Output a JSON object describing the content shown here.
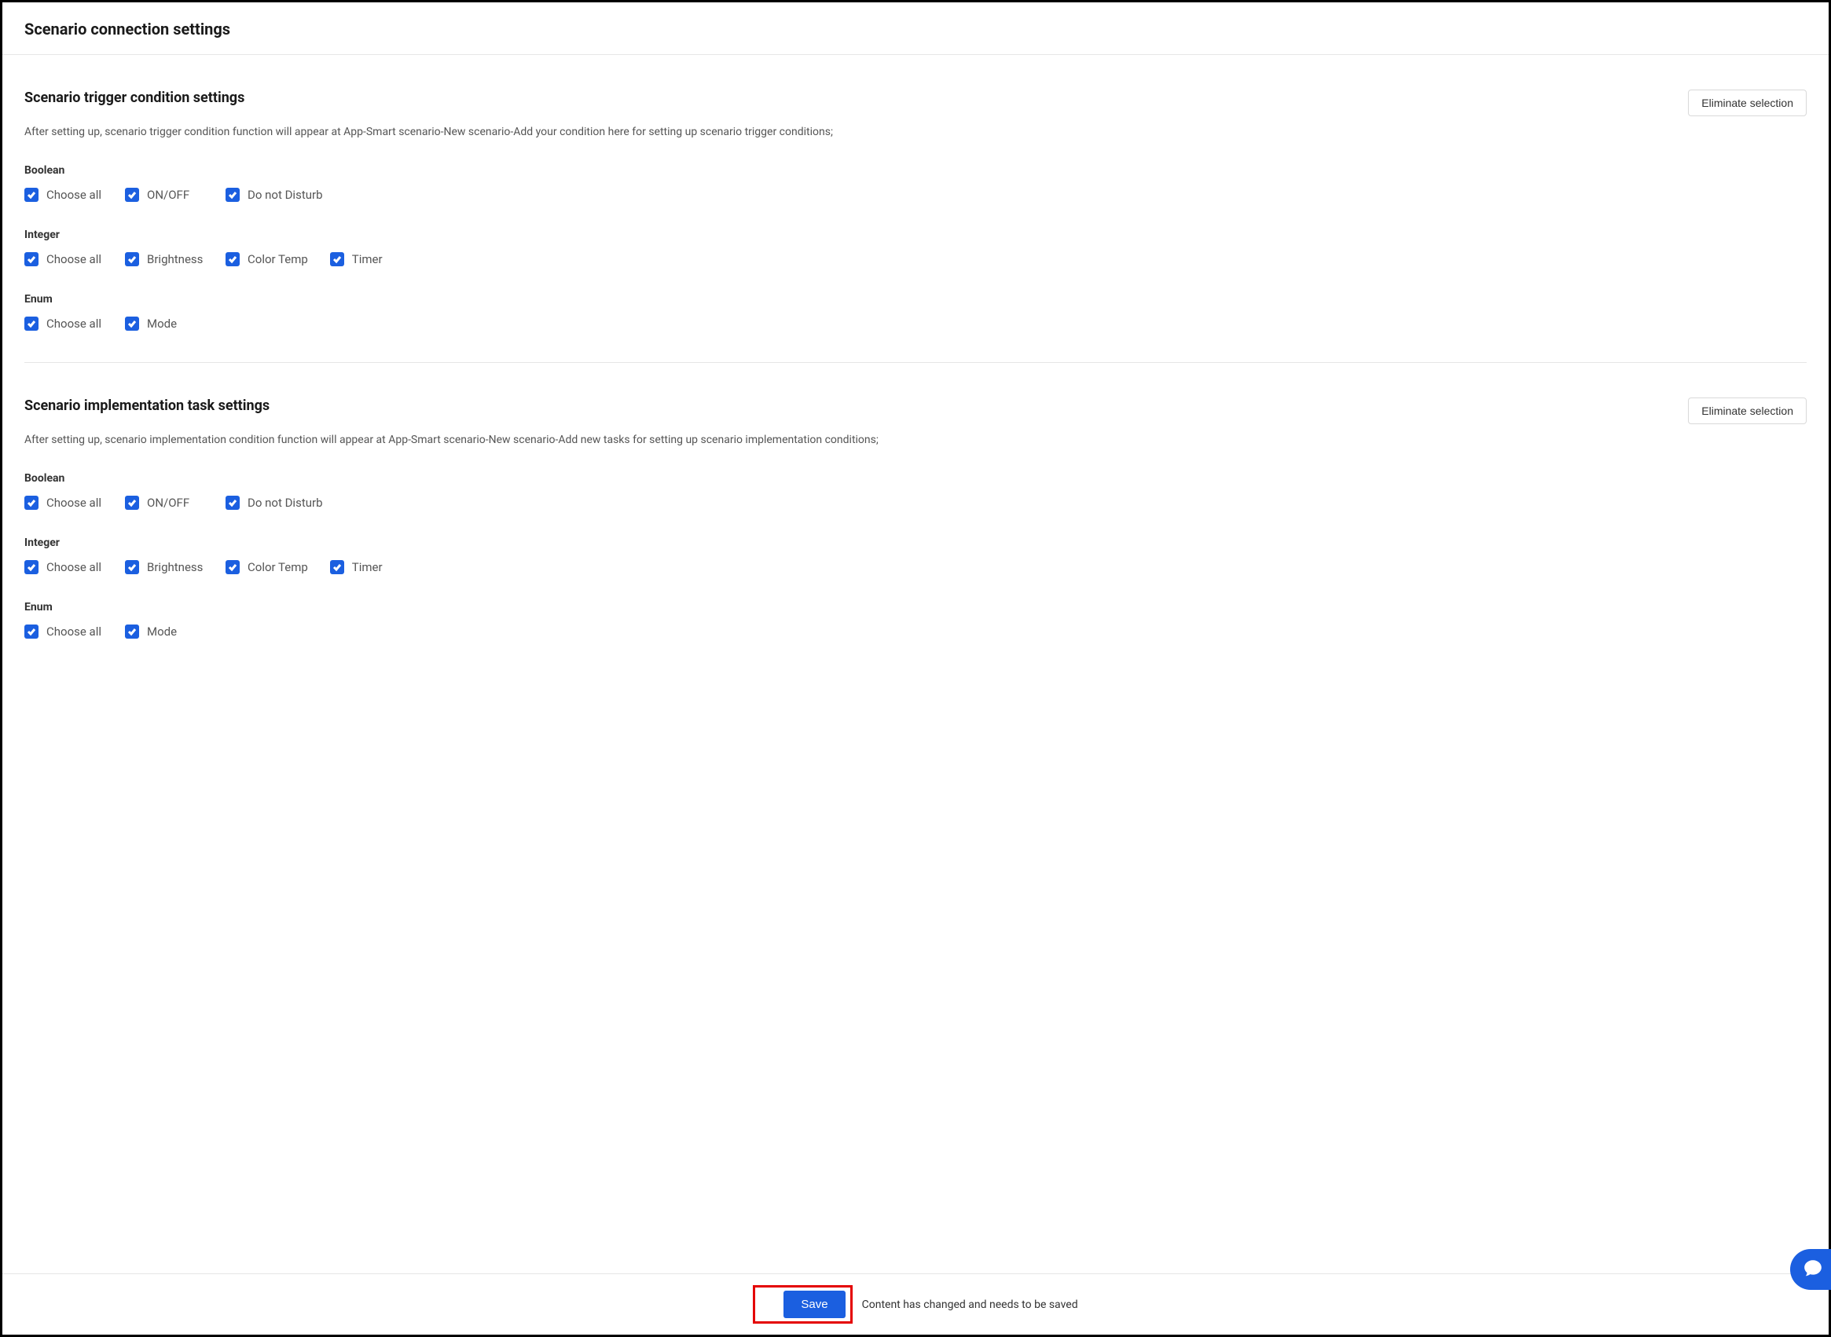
{
  "page_title": "Scenario connection settings",
  "eliminate_label": "Eliminate selection",
  "choose_all_label": "Choose all",
  "sections": {
    "trigger": {
      "title": "Scenario trigger condition settings",
      "desc": "After setting up, scenario trigger condition function will appear at App-Smart scenario-New scenario-Add your condition here for setting up scenario trigger conditions;",
      "groups": {
        "boolean": {
          "title": "Boolean",
          "items": [
            "ON/OFF",
            "Do not Disturb"
          ]
        },
        "integer": {
          "title": "Integer",
          "items": [
            "Brightness",
            "Color Temp",
            "Timer"
          ]
        },
        "enum": {
          "title": "Enum",
          "items": [
            "Mode"
          ]
        }
      }
    },
    "task": {
      "title": "Scenario implementation task settings",
      "desc": "After setting up, scenario implementation condition function will appear at App-Smart scenario-New scenario-Add new tasks for setting up scenario implementation conditions;",
      "groups": {
        "boolean": {
          "title": "Boolean",
          "items": [
            "ON/OFF",
            "Do not Disturb"
          ]
        },
        "integer": {
          "title": "Integer",
          "items": [
            "Brightness",
            "Color Temp",
            "Timer"
          ]
        },
        "enum": {
          "title": "Enum",
          "items": [
            "Mode"
          ]
        }
      }
    }
  },
  "footer": {
    "save_label": "Save",
    "message": "Content has changed and needs to be saved"
  }
}
